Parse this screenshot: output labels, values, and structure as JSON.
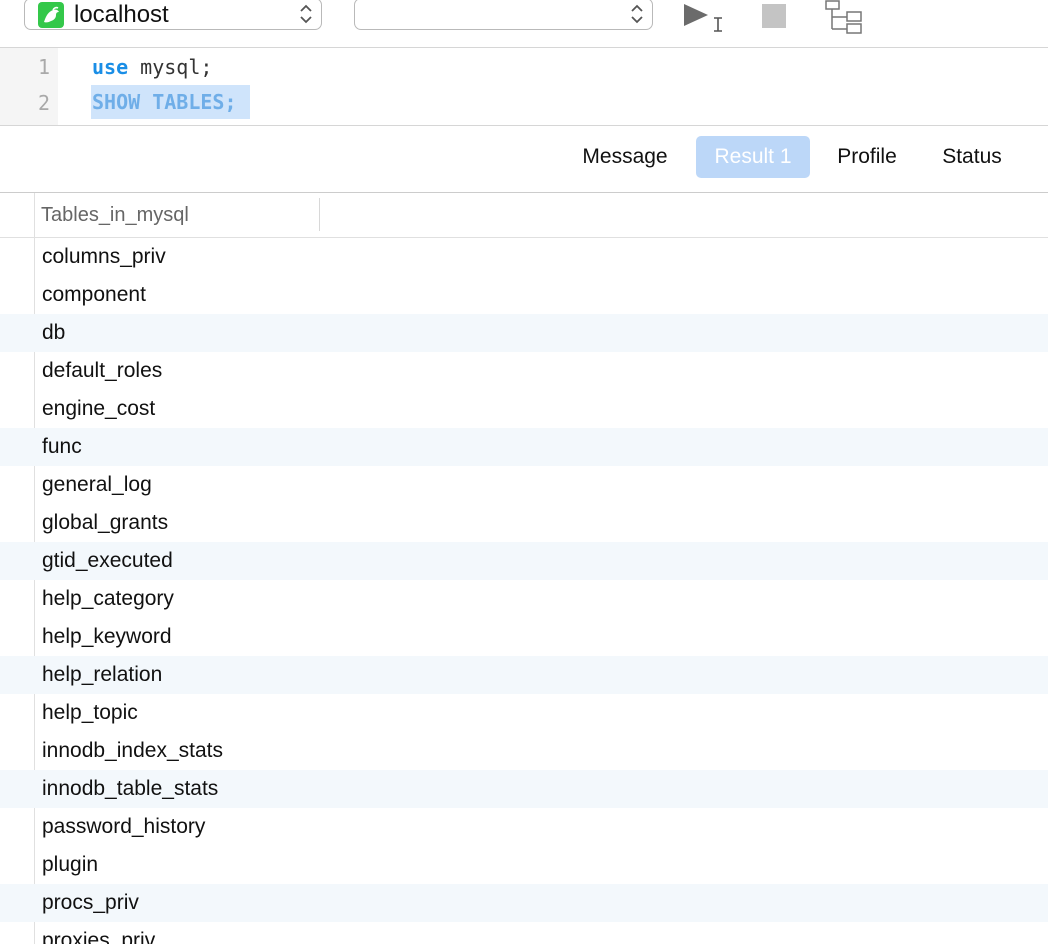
{
  "toolbar": {
    "connection": {
      "label": "localhost",
      "icon": "mysql-dolphin-icon",
      "icon_color": "#34c84a"
    },
    "database": {
      "value": ""
    },
    "buttons": {
      "run": "run-query-icon",
      "stop": "stop-icon",
      "explain": "explain-icon"
    }
  },
  "editor": {
    "lines": [
      {
        "number": "1",
        "keyword": "use",
        "rest": " mysql;"
      },
      {
        "number": "2",
        "text": "SHOW TABLES;"
      }
    ]
  },
  "tabs": [
    {
      "label": "Message",
      "active": false
    },
    {
      "label": "Result 1",
      "active": true
    },
    {
      "label": "Profile",
      "active": false
    },
    {
      "label": "Status",
      "active": false
    }
  ],
  "grid": {
    "column_header": "Tables_in_mysql",
    "rows": [
      "columns_priv",
      "component",
      "db",
      "default_roles",
      "engine_cost",
      "func",
      "general_log",
      "global_grants",
      "gtid_executed",
      "help_category",
      "help_keyword",
      "help_relation",
      "help_topic",
      "innodb_index_stats",
      "innodb_table_stats",
      "password_history",
      "plugin",
      "procs_priv",
      "proxies_priv"
    ]
  },
  "colors": {
    "accent": "#1a8ee6",
    "active_tab": "#bcd7f8",
    "alt_row": "#f3f8fc"
  }
}
